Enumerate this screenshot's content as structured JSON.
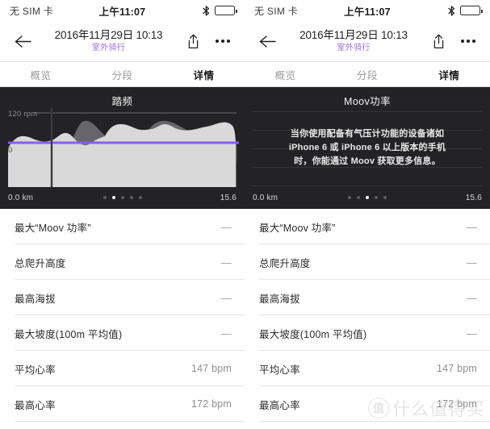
{
  "left": {
    "status_bar": {
      "carrier": "无 SIM 卡",
      "time": "上午11:07",
      "bluetooth_icon": "bluetooth-icon",
      "battery_icon": "battery-icon"
    },
    "nav": {
      "back_icon": "back-arrow-icon",
      "date": "2016年11月29日 10:13",
      "subtitle": "室外骑行",
      "share_icon": "share-icon",
      "more_icon": "more-options-icon"
    },
    "tabs": [
      {
        "label": "概览",
        "active": false
      },
      {
        "label": "分段",
        "active": false
      },
      {
        "label": "详情",
        "active": true
      }
    ],
    "chart": {
      "title": "踏频",
      "y_top_label": "120 rpm",
      "y_bottom_label": "0",
      "x_start": "0.0 km",
      "x_end": "15.6",
      "pager_total": 5,
      "pager_active": 2,
      "average_line_color": "#8b5cf6",
      "area_color": "#d9d9d9",
      "ghost_color": "#6f6f72",
      "background": "#232325"
    },
    "rows": [
      {
        "label": "最大“Moov 功率”",
        "value": "—"
      },
      {
        "label": "总爬升高度",
        "value": "—"
      },
      {
        "label": "最高海拔",
        "value": "—"
      },
      {
        "label": "最大坡度(100m 平均值)",
        "value": "—"
      },
      {
        "label": "平均心率",
        "value": "147 bpm"
      },
      {
        "label": "最高心率",
        "value": "172 bpm"
      }
    ]
  },
  "right": {
    "status_bar": {
      "carrier": "无 SIM 卡",
      "time": "上午11:07",
      "bluetooth_icon": "bluetooth-icon",
      "battery_icon": "battery-icon"
    },
    "nav": {
      "back_icon": "back-arrow-icon",
      "date": "2016年11月29日 10:13",
      "subtitle": "室外骑行",
      "share_icon": "share-icon",
      "more_icon": "more-options-icon"
    },
    "tabs": [
      {
        "label": "概览",
        "active": false
      },
      {
        "label": "分段",
        "active": false
      },
      {
        "label": "详情",
        "active": true
      }
    ],
    "chart": {
      "title": "Moov功率",
      "message_line1": "当你使用配备有气压计功能的设备诸如",
      "message_line2": "iPhone 6 或 iPhone 6 以上版本的手机",
      "message_line3": "时，你能通过 Moov 获取更多信息。",
      "x_start": "0.0 km",
      "x_end": "15.6",
      "pager_total": 5,
      "pager_active": 3,
      "background": "#232325"
    },
    "rows": [
      {
        "label": "最大“Moov 功率”",
        "value": "—"
      },
      {
        "label": "总爬升高度",
        "value": "—"
      },
      {
        "label": "最高海拔",
        "value": "—"
      },
      {
        "label": "最大坡度(100m 平均值)",
        "value": "—"
      },
      {
        "label": "平均心率",
        "value": "147 bpm"
      },
      {
        "label": "最高心率",
        "value": "172 bpm"
      }
    ]
  },
  "watermark": {
    "badge": "值",
    "text": "什么值得买"
  },
  "chart_data": {
    "type": "area",
    "title": "踏频",
    "xlabel": "km",
    "ylabel": "rpm",
    "ylim": [
      0,
      120
    ],
    "xlim": [
      0.0,
      15.6
    ],
    "grid": false,
    "legend": "none",
    "x_tick_labels": [
      "0.0 km",
      "15.6"
    ],
    "y_tick_labels": [
      "120 rpm",
      "0"
    ],
    "series": [
      {
        "name": "踏频 (cadence)",
        "color": "#d9d9d9",
        "values": [
          63,
          78,
          76,
          72,
          70,
          69,
          68,
          70,
          77,
          78,
          72,
          66,
          66,
          68,
          80,
          84,
          84,
          82,
          83,
          82,
          81,
          80,
          82,
          86,
          83,
          81,
          80,
          80,
          80,
          81,
          82,
          81,
          80,
          80,
          81,
          83,
          85,
          86,
          86,
          85,
          84,
          83,
          84,
          86,
          87,
          86,
          84,
          80,
          72,
          60,
          46
        ]
      },
      {
        "name": "海拔 (ghost / elevation)",
        "color": "#6f6f72",
        "values": [
          40,
          44,
          46,
          44,
          40,
          36,
          34,
          33,
          40,
          52,
          84,
          86,
          82,
          74,
          66,
          58,
          52,
          48,
          46,
          48,
          52,
          58,
          62,
          66,
          70,
          74,
          80,
          88,
          92,
          94,
          92,
          88,
          84,
          84,
          88,
          90,
          88,
          84,
          80,
          78,
          78,
          80,
          82,
          82,
          80,
          76,
          70,
          62,
          54,
          46,
          38
        ]
      }
    ],
    "annotations": [
      {
        "type": "hline",
        "label": "平均踏频",
        "value": 74,
        "color": "#8b5cf6"
      },
      {
        "type": "vline",
        "label": "分段标记",
        "value": 3.0,
        "color": "#3a3a3c"
      }
    ]
  }
}
